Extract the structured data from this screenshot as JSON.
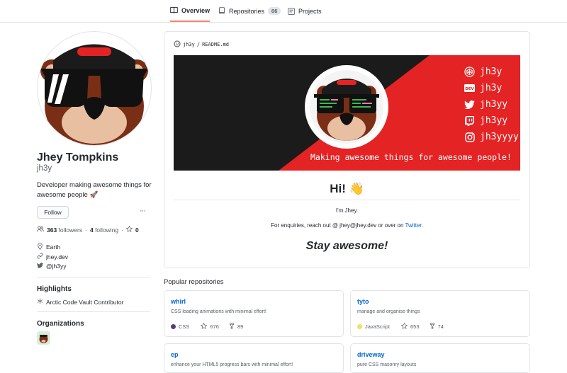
{
  "tabs": [
    {
      "label": "Overview",
      "icon": "book-icon"
    },
    {
      "label": "Repositories",
      "icon": "repo-icon",
      "count": "86"
    },
    {
      "label": "Projects",
      "icon": "project-icon"
    }
  ],
  "profile": {
    "name": "Jhey Tompkins",
    "login": "jh3y",
    "bio": "Developer making awesome things for awesome people 🚀",
    "follow_label": "Follow",
    "more_label": "···",
    "followers_count": "363",
    "followers_label": "followers",
    "following_count": "4",
    "following_label": "following",
    "stars_count": "0",
    "location": "Earth",
    "website": "jhey.dev",
    "twitter": "@jh3yy"
  },
  "highlights": {
    "title": "Highlights",
    "item": "Arctic Code Vault Contributor"
  },
  "organizations": {
    "title": "Organizations"
  },
  "readme": {
    "owner": "jh3y",
    "file": "README.md",
    "banner_handles": [
      "jh3y",
      "jh3y",
      "jh3yy",
      "jh3yy",
      "jh3yyyy"
    ],
    "banner_tagline": "Making awesome things for awesome people!",
    "greeting": "Hi! 👋",
    "intro": "I'm Jhey.",
    "enquiries_prefix": "For enquiries, reach out @ jhey@jhey.dev or over on ",
    "enquiries_link": "Twitter",
    "enquiries_suffix": ".",
    "signoff": "Stay awesome!"
  },
  "popular": {
    "title": "Popular repositories",
    "repos": [
      {
        "name": "whirl",
        "desc": "CSS loading animations with minimal effort!",
        "lang": "CSS",
        "lang_color": "#563d7c",
        "stars": "676",
        "forks": "89"
      },
      {
        "name": "tyto",
        "desc": "manage and organise things",
        "lang": "JavaScript",
        "lang_color": "#f1e05a",
        "stars": "653",
        "forks": "74"
      },
      {
        "name": "ep",
        "desc": "enhance your HTML5 progress bars with minimal effort!"
      },
      {
        "name": "driveway",
        "desc": "pure CSS masonry layouts"
      }
    ]
  },
  "colors": {
    "banner_dark": "#1b1b1b",
    "banner_red": "#e42324",
    "link": "#0366d6",
    "tab_accent": "#f9826c"
  }
}
